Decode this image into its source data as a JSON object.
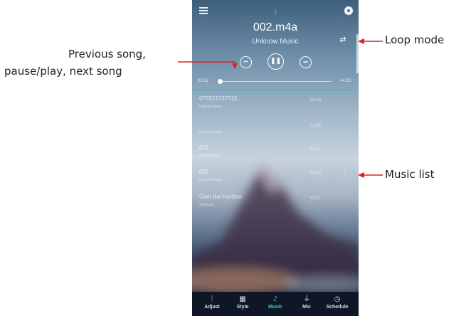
{
  "player": {
    "song_title": "002.m4a",
    "artist": "Unknow Music",
    "elapsed": "00:12",
    "total": "44:23",
    "progress": 0.02,
    "accent_color": "#37c0cf",
    "icons": {
      "menu": "menu-icon",
      "logo": "music-note-icon",
      "settings": "settings-icon",
      "loop": "repeat-icon",
      "prev": "skip-previous-icon",
      "play_pause": "pause-icon",
      "next": "skip-next-icon"
    }
  },
  "playlist": [
    {
      "title": "075521537015...",
      "subtitle": "Unknow Music",
      "duration": "06:48"
    },
    {
      "title": "",
      "subtitle": "Unknow Music",
      "duration": "01:38"
    },
    {
      "title": "001",
      "subtitle": "Unknow Music",
      "duration": "51:14"
    },
    {
      "title": "002",
      "subtitle": "Unknow Music",
      "duration": "44:23",
      "playing_icon": "music-note-icon"
    },
    {
      "title": "Over the Horizon",
      "subtitle": "Samsung",
      "duration": "03:11"
    }
  ],
  "tabs": [
    {
      "label": "Adjust",
      "icon": "sliders-icon",
      "active": false
    },
    {
      "label": "Style",
      "icon": "grid-icon",
      "active": false
    },
    {
      "label": "Music",
      "icon": "music-note-icon",
      "active": true
    },
    {
      "label": "Mic",
      "icon": "microphone-icon",
      "active": false
    },
    {
      "label": "Schedule",
      "icon": "timer-icon",
      "active": false
    }
  ],
  "annotations": {
    "loop": "Loop mode",
    "controls_line1": "Previous song,",
    "controls_line2": "pause/play, next song",
    "list": "Music list",
    "arrow_color": "#e02020"
  }
}
